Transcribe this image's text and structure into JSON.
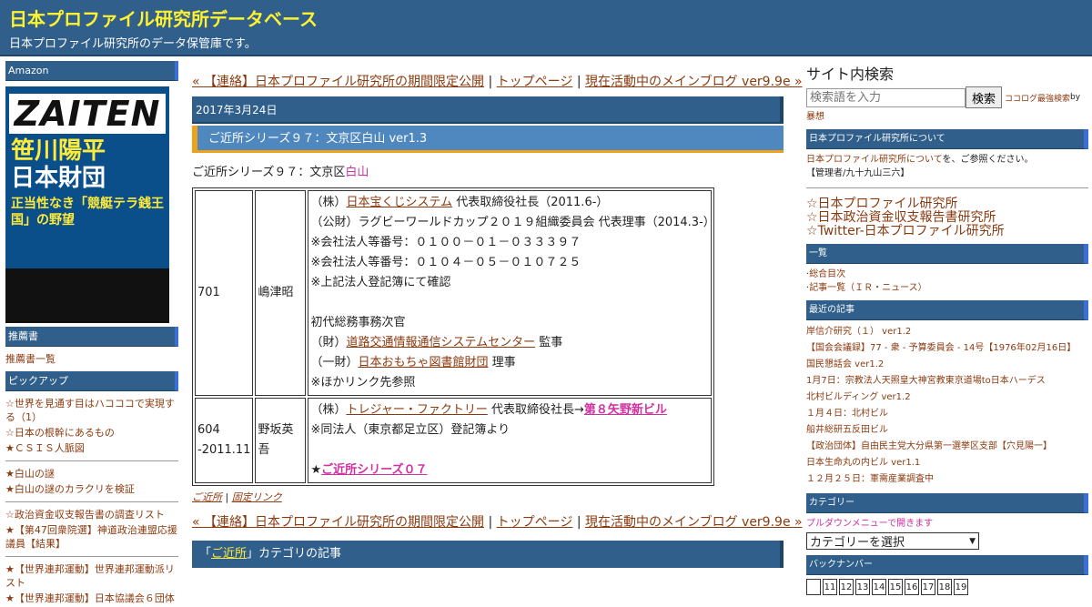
{
  "header": {
    "title": "日本プロファイル研究所データベース",
    "subtitle": "日本プロファイル研究所のデータ保管庫です。"
  },
  "left": {
    "amazon_heading": "Amazon",
    "magazine": {
      "masthead": "ZAITEN",
      "line1": "笹川陽平",
      "line2": "日本財団",
      "line3": "正当性なき「競艇テラ銭王国」の野望"
    },
    "recommend_heading": "推薦書",
    "recommend_link": "推薦書一覧",
    "pickup_heading": "ピックアップ",
    "group1": [
      "☆世界を見通す目はハコココで実現する（1）",
      "☆日本の根幹にあるもの",
      "★ＣＳＩＳ人脈図"
    ],
    "group2": [
      "★白山の謎",
      "★白山の謎のカラクリを検証"
    ],
    "group3": [
      "☆政治資金収支報告書の調査リスト",
      "★【第47回衆院選】神道政治連盟応援議員【結果】"
    ],
    "group4": [
      "★【世界連邦運動】世界連邦運動派リスト",
      "★【世界連邦運動】日本協議会６団体"
    ]
  },
  "main": {
    "nav": {
      "prev": "« 【連絡】日本プロファイル研究所の期間限定公開",
      "sep1": " | ",
      "top": "トップページ",
      "sep2": " | ",
      "next": "現在活動中のメインブログ ver9.9e »"
    },
    "date": "2017年3月24日",
    "title": "ご近所シリーズ９７：文京区白山 ver1.3",
    "intro_prefix": "ご近所シリーズ９７：文京区",
    "intro_link": "白山",
    "rows": [
      {
        "num": "701",
        "name": "嶋津昭",
        "l1_pre": "（株）",
        "l1_link": "日本宝くじシステム",
        "l1_post": " 代表取締役社長（2011.6-）",
        "l2": "（公財）ラグビーワールドカップ２０１９組織委員会 代表理事（2014.3-）",
        "l3": "※会社法人等番号：０１００－０１－０３３３９７",
        "l4": "※会社法人等番号：０１０４－０５－０１０７２５",
        "l5": "※上記法人登記簿にて確認",
        "l6": "初代総務事務次官",
        "l7_pre": "（財）",
        "l7_link": "道路交通情報通信システムセンター",
        "l7_post": " 監事",
        "l8_pre": "（一財）",
        "l8_link": "日本おもちゃ図書館財団",
        "l8_post": " 理事",
        "l9": "※ほかリンク先参照"
      },
      {
        "num": "604",
        "num2": "-2011.11",
        "name": "野坂英吾",
        "l1_pre": "（株）",
        "l1_link": "トレジャー・ファクトリー",
        "l1_post": " 代表取締役社長→",
        "l1_link2": "第８矢野新ビル",
        "l2": "※同法人（東京都足立区）登記簿より",
        "l3_pre": "★",
        "l3_link": "ご近所シリーズ０７"
      }
    ],
    "foot": {
      "cat": "ご近所",
      "sep": " | ",
      "perma": "固定リンク"
    },
    "nav2": {
      "prev": "« 【連絡】日本プロファイル研究所の期間限定公開",
      "sep1": " | ",
      "top": "トップページ",
      "sep2": " | ",
      "next": "現在活動中のメインブログ ver9.9e »"
    },
    "category_box": {
      "pre": "「",
      "link": "ご近所",
      "post": "」カテゴリの記事"
    }
  },
  "right": {
    "search_title": "サイト内検索",
    "search_placeholder": "検索語を入力",
    "search_button": "検索",
    "cocolog_link": "ココログ最強検索",
    "cocolog_by": " by",
    "cocolog_line2": "暴想",
    "about_heading": "日本プロファイル研究所について",
    "about_link": "日本プロファイル研究所について",
    "about_post": "を、ご参照ください。",
    "about_admin": "【管理者/九十九山三六】",
    "links": [
      "☆日本プロファイル研究所",
      "☆日本政治資金収支報告書研究所",
      "☆Twitter-日本プロファイル研究所"
    ],
    "list_heading": "一覧",
    "list_items": [
      "総合目次",
      "記事一覧（ＩＲ・ニュース）"
    ],
    "recent_heading": "最近の記事",
    "recent": [
      "岸信介研究（１） ver1.2",
      "【国会会議録】77 - 衆 - 予算委員会 - 14号【1976年02月16日】",
      "国民懇話会 ver1.2",
      "1月7日：宗教法人天照皇大神宮教東京道場to日本ハーデス",
      "北村ビルディング ver1.2",
      "１月４日：北村ビル",
      "船井総研五反田ビル",
      "【政治団体】自由民主党大分県第一選挙区支部【穴見陽一】",
      "日本生命丸の内ビル ver1.1",
      "１２月２５日：軍需産業調査中"
    ],
    "category_heading": "カテゴリー",
    "category_note": "プルダウンメニューで開きます",
    "category_select": "カテゴリーを選択",
    "backnumber_heading": "バックナンバー",
    "backnumbers": [
      "",
      "11",
      "12",
      "13",
      "14",
      "15",
      "16",
      "17",
      "18",
      "19"
    ]
  }
}
